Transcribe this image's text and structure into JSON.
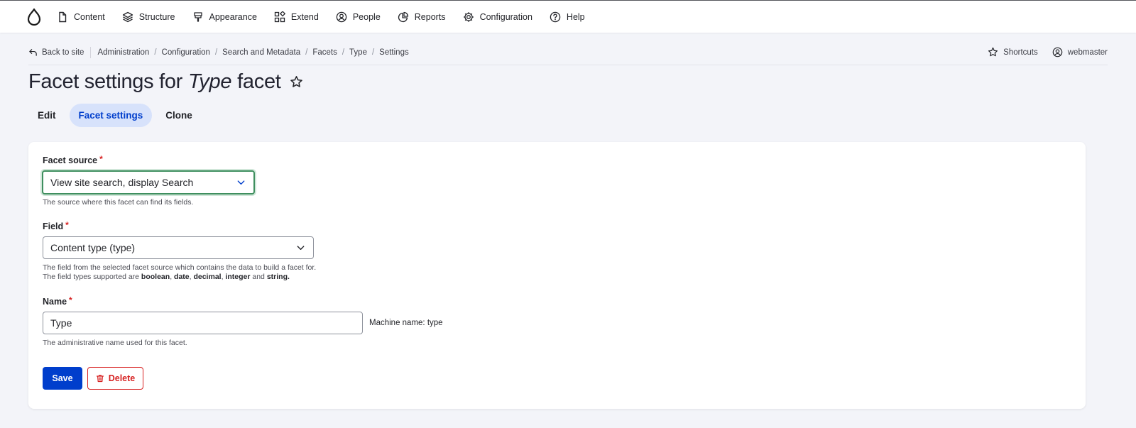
{
  "toolbar": {
    "logo_icon": "drupal-drop-icon",
    "items": [
      {
        "label": "Content",
        "icon": "file-icon"
      },
      {
        "label": "Structure",
        "icon": "layers-icon"
      },
      {
        "label": "Appearance",
        "icon": "brush-icon"
      },
      {
        "label": "Extend",
        "icon": "puzzle-icon"
      },
      {
        "label": "People",
        "icon": "user-circle-icon"
      },
      {
        "label": "Reports",
        "icon": "chart-pie-icon"
      },
      {
        "label": "Configuration",
        "icon": "gear-icon"
      },
      {
        "label": "Help",
        "icon": "question-icon"
      }
    ]
  },
  "breadcrumb": {
    "back_label": "Back to site",
    "items": [
      "Administration",
      "Configuration",
      "Search and Metadata",
      "Facets",
      "Type",
      "Settings"
    ],
    "shortcuts_label": "Shortcuts",
    "user_label": "webmaster"
  },
  "page": {
    "title_prefix": "Facet settings for",
    "title_emphasis": "Type",
    "title_suffix": "facet"
  },
  "tabs": [
    {
      "label": "Edit",
      "active": false
    },
    {
      "label": "Facet settings",
      "active": true
    },
    {
      "label": "Clone",
      "active": false
    }
  ],
  "form": {
    "facet_source": {
      "label": "Facet source",
      "required_mark": "*",
      "value": "View site search, display Search",
      "description": "The source where this facet can find its fields."
    },
    "field": {
      "label": "Field",
      "required_mark": "*",
      "value": "Content type (type)",
      "description_line1": "The field from the selected facet source which contains the data to build a facet for.",
      "description_line2_prefix": "The field types supported are",
      "types": [
        "boolean",
        "date",
        "decimal",
        "integer"
      ],
      "types_and": "and",
      "type_last": "string",
      "period": "."
    },
    "name": {
      "label": "Name",
      "required_mark": "*",
      "value": "Type",
      "machine_name": "Machine name: type",
      "description": "The administrative name used for this facet."
    },
    "save_label": "Save",
    "delete_label": "Delete"
  },
  "colors": {
    "accent": "#003ecc",
    "danger": "#d72222",
    "focus": "#3f8f5f",
    "tab_active_bg": "#d7e2fb"
  }
}
